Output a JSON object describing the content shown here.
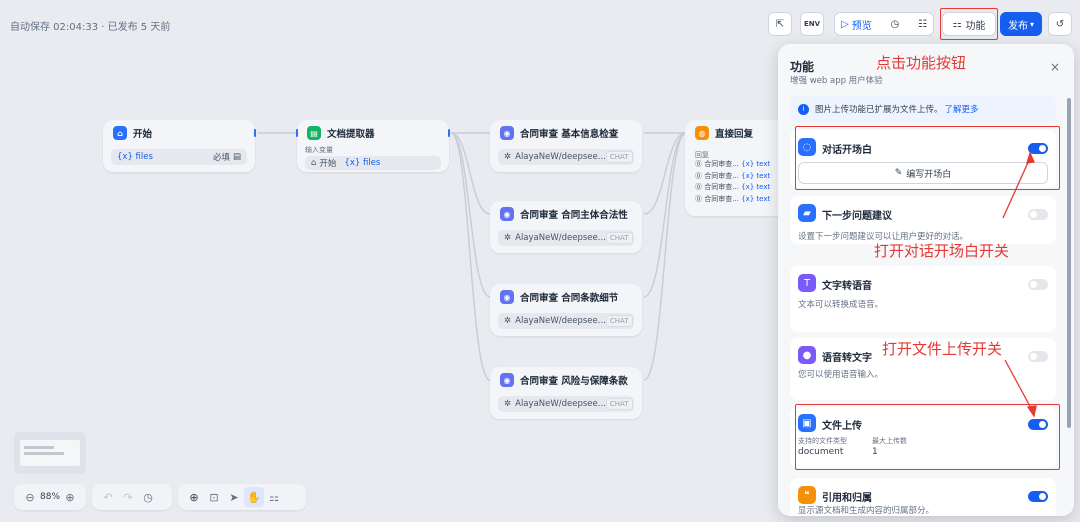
{
  "status": "自动保存 02:04:33 · 已发布 5 天前",
  "toolbar_top": {
    "preview_label": "预览",
    "features_label": "功能",
    "publish_label": "发布"
  },
  "nodes": {
    "start": {
      "title": "开始",
      "var": "{x} files",
      "required": "必填"
    },
    "doc": {
      "title": "文档提取器",
      "input_label": "输入变量",
      "input_src": "开始",
      "input_var": "{x} files"
    },
    "llm1": {
      "title": "合同审查 基本信息检查",
      "model": "AlayaNeW/deepsee...",
      "chip": "CHAT"
    },
    "llm2": {
      "title": "合同审查 合同主体合法性",
      "model": "AlayaNeW/deepsee...",
      "chip": "CHAT"
    },
    "llm3": {
      "title": "合同审查 合同条款细节",
      "model": "AlayaNeW/deepsee...",
      "chip": "CHAT"
    },
    "llm4": {
      "title": "合同审查 风险与保障条款",
      "model": "AlayaNeW/deepsee...",
      "chip": "CHAT"
    },
    "answer": {
      "title": "直接回复",
      "label": "回复",
      "rows": [
        {
          "name": "合同审查...",
          "var": "{x} text"
        },
        {
          "name": "合同审查...",
          "var": "{x} text"
        },
        {
          "name": "合同审查...",
          "var": "{x} text"
        },
        {
          "name": "合同审查...",
          "var": "{x} text"
        }
      ]
    }
  },
  "zoom": "88%",
  "panel": {
    "title": "功能",
    "subtitle": "增强 web app 用户体验",
    "notice": "图片上传功能已扩展为文件上传。",
    "notice_link": "了解更多",
    "opener": {
      "title": "对话开场白",
      "button": "编写开场白"
    },
    "suggest": {
      "title": "下一步问题建议",
      "desc": "设置下一步问题建议可以让用户更好的对话。"
    },
    "tts": {
      "title": "文字转语音",
      "desc": "文本可以转换成语音。"
    },
    "stt": {
      "title": "语音转文字",
      "desc": "您可以使用语音输入。"
    },
    "upload": {
      "title": "文件上传",
      "types_label": "支持的文件类型",
      "types_value": "document",
      "max_label": "最大上传数",
      "max_value": "1"
    },
    "citation": {
      "title": "引用和归属",
      "desc": "显示源文档和生成内容的归属部分。"
    }
  },
  "annotations": {
    "click_feature": "点击功能按钮",
    "open_opener": "打开对话开场白开关",
    "open_upload": "打开文件上传开关"
  },
  "colors": {
    "accent": "#155eef",
    "annotation": "#e53935"
  }
}
